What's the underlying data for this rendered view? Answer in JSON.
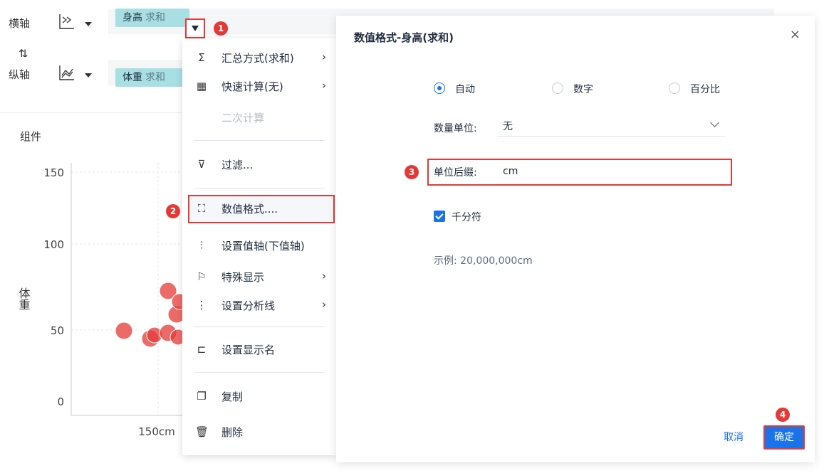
{
  "axes": {
    "x_label": "横轴",
    "y_label": "纵轴",
    "x_field": "身高",
    "x_agg": "求和",
    "y_field": "体重",
    "y_agg": "求和"
  },
  "steps": [
    "1",
    "2",
    "3",
    "4"
  ],
  "chart": {
    "title": "组件",
    "ylabel": "体重",
    "y_ticks": [
      "150",
      "100",
      "50",
      "0"
    ],
    "x_ticks": [
      "150cm"
    ]
  },
  "chart_data": {
    "type": "scatter",
    "title": "",
    "ylabel": "体重",
    "xlabel": "",
    "ylim": [
      0,
      150
    ],
    "x_tick_labels": [
      "150cm"
    ],
    "y_tick_labels": [
      "0",
      "50",
      "100",
      "150"
    ],
    "points_color": "#e53935"
  },
  "menu": {
    "items": [
      {
        "icon": "Σ",
        "label": "汇总方式(求和)",
        "arrow": "›"
      },
      {
        "icon": "▦",
        "label": "快速计算(无)",
        "arrow": "›"
      },
      {
        "icon": "",
        "label": "二次计算",
        "arrow": ""
      },
      {
        "icon": "⊽",
        "label": "过滤...",
        "arrow": ""
      },
      {
        "icon": "⛶",
        "label": "数值格式....",
        "arrow": ""
      },
      {
        "icon": "⫶",
        "label": "设置值轴(下值轴)",
        "arrow": ""
      },
      {
        "icon": "⚐",
        "label": "特殊显示",
        "arrow": "›"
      },
      {
        "icon": "⋮",
        "label": "设置分析线",
        "arrow": "›"
      },
      {
        "icon": "⊏",
        "label": "设置显示名",
        "arrow": ""
      },
      {
        "icon": "❐",
        "label": "复制",
        "arrow": ""
      },
      {
        "icon": "🗑",
        "label": "删除",
        "arrow": ""
      }
    ]
  },
  "dialog": {
    "title": "数值格式-身高(求和)",
    "close": "×",
    "radios": [
      "自动",
      "数字",
      "百分比"
    ],
    "unit_label": "数量单位:",
    "unit_value": "无",
    "suffix_label": "单位后缀:",
    "suffix_value": "cm",
    "thousands_label": "千分符",
    "example": "示例: 20,000,000cm",
    "cancel": "取消",
    "ok": "确定"
  },
  "colors": {
    "accent": "#1a73e8",
    "marker": "#e53935",
    "pill": "#a8dfe3"
  }
}
